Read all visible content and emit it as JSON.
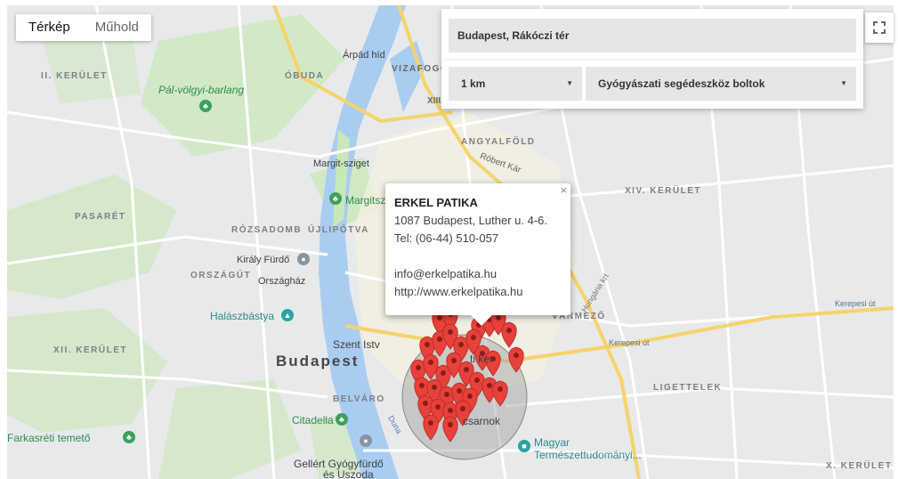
{
  "map_type": {
    "active": "Térkép",
    "inactive": "Műhold"
  },
  "search": {
    "value": "Budapest, Rákóczi tér"
  },
  "filters": {
    "radius": "1 km",
    "category": "Gyógyászati segédeszköz boltok"
  },
  "info": {
    "name": "ERKEL PATIKA",
    "address": "1087 Budapest, Luther u. 4-6.",
    "phone": "Tel: (06-44) 510-057",
    "email": "info@erkelpatika.hu",
    "web": "http://www.erkelpatika.hu",
    "close": "×"
  },
  "labels": {
    "ii_kerulet": "II. KERÜLET",
    "obuda": "ÓBUDA",
    "vizafogo": "VIZAFOGÓ",
    "arpad_hid": "Árpád híd",
    "pal_volgyi": "Pál-völgyi-barlang",
    "angyalfold": "ANGYALFÖLD",
    "margit_sziget": "Margit-sziget",
    "margitsziget_poi": "Margitsz",
    "xiv_kerulet": "XIV. KERÜLET",
    "pasaret": "PASARÉT",
    "rozsadomb": "RÓZSADOMB",
    "ujlipotvaros": "ÚJLIPÓTVA",
    "kiraly_furdo": "Király Fürdő",
    "orszagut": "ORSZÁGÚT",
    "orszaghaz": "Országház",
    "halaszbastya": "Halászbástya",
    "xii_kerulet": "XII. KERÜLET",
    "szent_istvan": "Szent Istv",
    "budapest": "Budapest",
    "belvaros": "BELVÁRO",
    "citadella": "Citadella",
    "farkasreti": "Farkasréti temető",
    "gellert": "Gellért Gyógyfürdő",
    "es_uszoda": "és Uszoda",
    "magyar": "Magyar",
    "termeszettud": "Természettudományi...",
    "ligetelek": "LIGETTELEK",
    "x_kerulet": "X. KERÜLET",
    "kerepesi": "Kerepesi út",
    "kerepesi2": "Kerepesi út",
    "vanmezo": "VÁNMEZŐ",
    "csarnok": "csarnok",
    "utiker": "ti ker",
    "robert": "Róbert Kár",
    "duna": "Duna",
    "xiii": "XIII.",
    "hungaria": "Hungária krt"
  },
  "colors": {
    "water": "#a9cdf0",
    "park": "#c9e8b8",
    "pin": "#e8403a",
    "radius": "#9e9e9e"
  },
  "icons": {
    "fullscreen": "fullscreen-icon",
    "pin": "map-pin-icon"
  }
}
